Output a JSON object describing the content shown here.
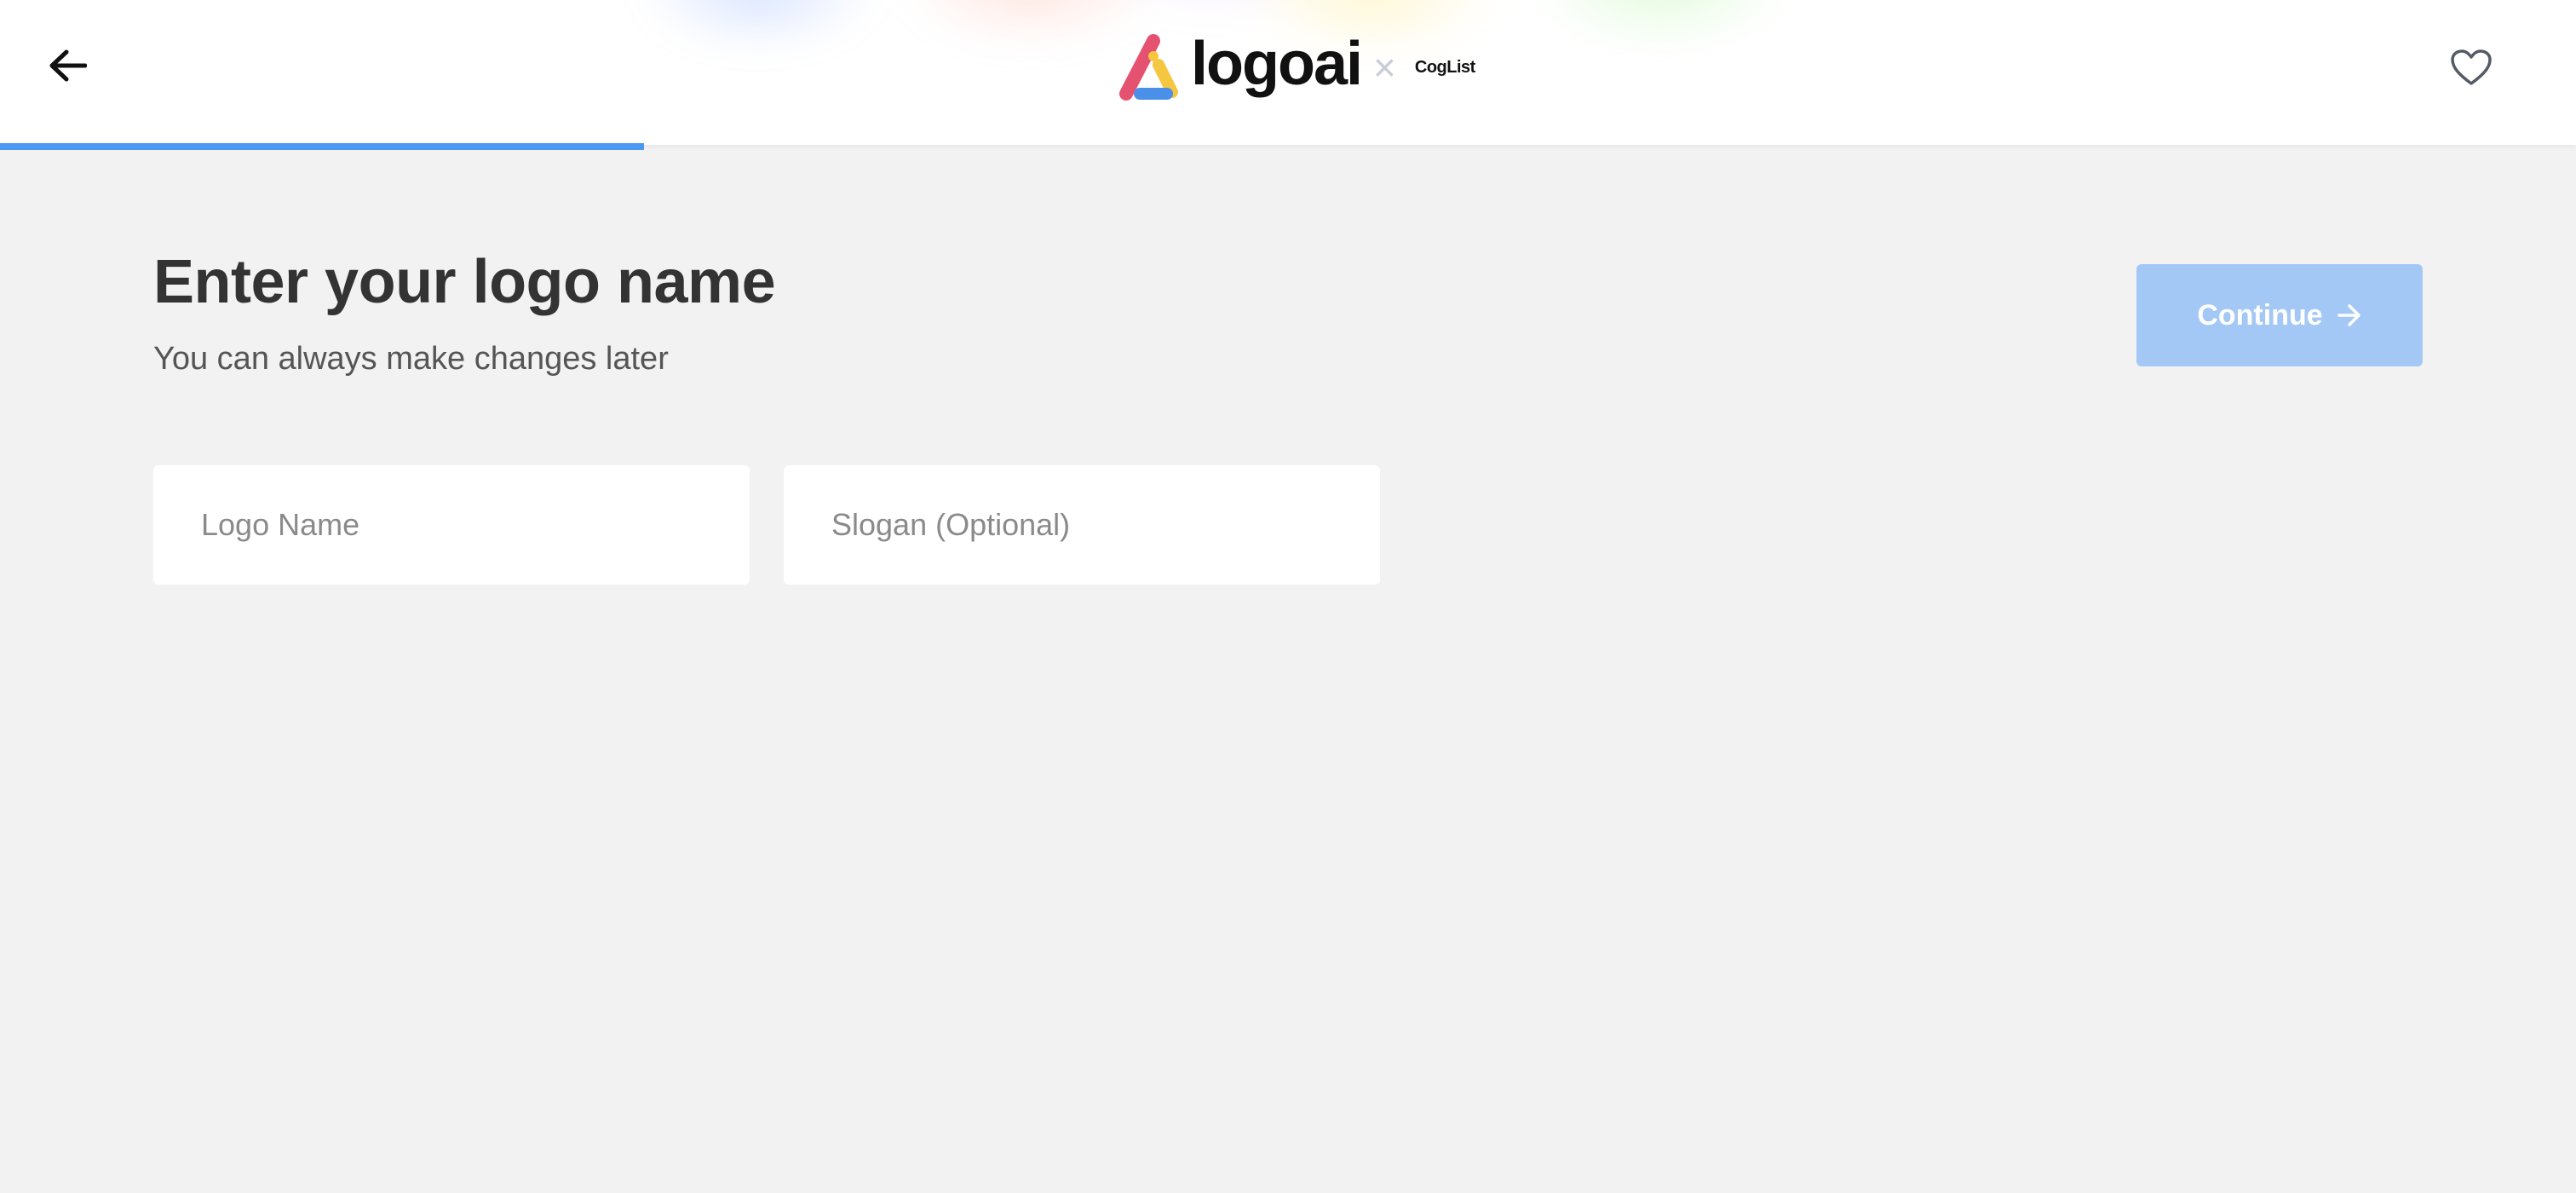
{
  "header": {
    "brand_name": "logoai",
    "separator": "×",
    "partner_name": "CogList",
    "back_icon": "arrow-left-icon",
    "favorite_icon": "heart-outline-icon"
  },
  "progress": {
    "fraction": 0.25,
    "color": "#4a99f2"
  },
  "main": {
    "title": "Enter your logo name",
    "subtitle": "You can always make changes later",
    "continue_label": "Continue",
    "continue_icon": "arrow-right-icon",
    "logo_name": {
      "value": "",
      "placeholder": "Logo Name"
    },
    "slogan": {
      "value": "",
      "placeholder": "Slogan (Optional)"
    }
  },
  "colors": {
    "accent": "#4a99f2",
    "button_disabled": "#a3c8f5",
    "background": "#f2f2f2",
    "brand_red": "#e5526f",
    "brand_yellow": "#f5c640",
    "brand_blue": "#4a8fe8"
  }
}
